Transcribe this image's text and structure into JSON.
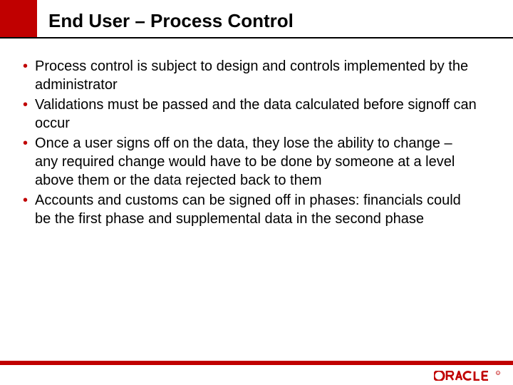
{
  "slide": {
    "title": "End User – Process Control",
    "bullets": [
      "Process control is subject to design and controls implemented by the administrator",
      "Validations must be passed and the data calculated before signoff can occur",
      "Once a user signs off on the data, they lose the ability to change – any required change would have to be done by someone at a level above them or the data rejected back to them",
      "Accounts and customs can be signed off in phases: financials could be the first phase and supplemental data in the second phase"
    ]
  },
  "brand": {
    "name": "ORACLE",
    "accent": "#c00000"
  }
}
